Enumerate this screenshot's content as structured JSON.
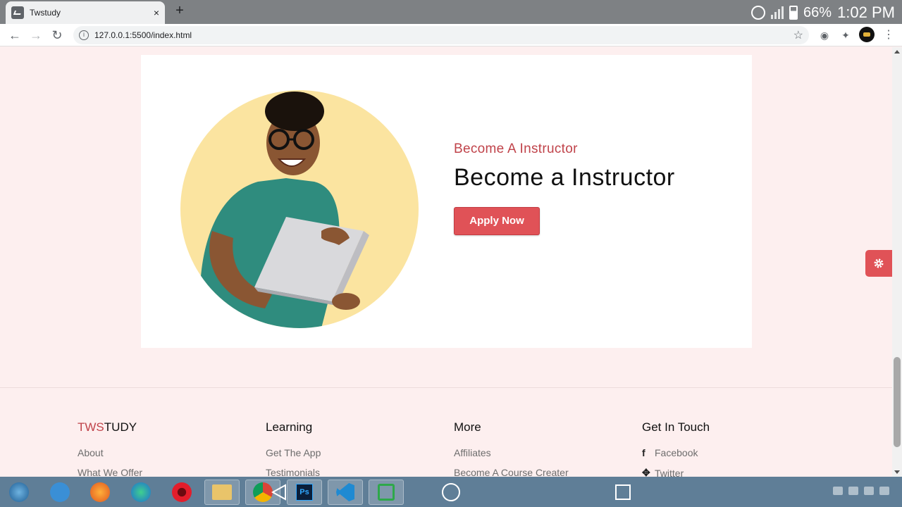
{
  "browser": {
    "tab_title": "Twstudy",
    "tab_close": "×",
    "new_tab": "+",
    "url": "127.0.0.1:5500/index.html"
  },
  "status_bar": {
    "battery_pct": "66%",
    "time": "1:02 PM"
  },
  "instructor": {
    "eyebrow": "Become A Instructor",
    "heading": "Become a Instructor",
    "button_label": "Apply Now"
  },
  "footer": {
    "brand_prefix": "TWS",
    "brand_suffix": "TUDY",
    "brand_links": [
      "About",
      "What We Offer"
    ],
    "learning_title": "Learning",
    "learning_links": [
      "Get The App",
      "Testimonials"
    ],
    "more_title": "More",
    "more_links": [
      "Affiliates",
      "Become A Course Creater"
    ],
    "touch_title": "Get In Touch",
    "touch_links": [
      "Facebook",
      "Twitter"
    ]
  },
  "colors": {
    "accent": "#e05257",
    "accent_text": "#c0434a",
    "page_bg": "#fdefef",
    "hero_circle": "#fbe4a0"
  },
  "taskbar": {
    "apps": [
      "start-orb",
      "internet-explorer",
      "firefox",
      "edge",
      "opera",
      "file-explorer",
      "chrome",
      "photoshop",
      "vscode",
      "camtasia"
    ]
  }
}
